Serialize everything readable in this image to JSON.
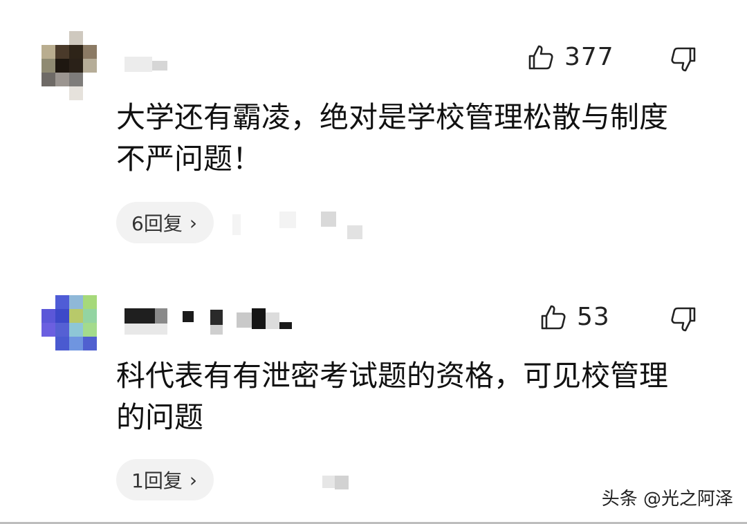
{
  "comments": [
    {
      "likes": "377",
      "text_line1": "大学还有霸凌，绝对是学校管理松散与制度",
      "text_line2": "不严问题！",
      "reply_label": "6回复"
    },
    {
      "likes": "53",
      "text_line1": "科代表有有泄密考试题的资格，可见校管理",
      "text_line2": "的问题",
      "reply_label": "1回复"
    }
  ],
  "watermark": "头条 @光之阿泽",
  "icons": {
    "like": "thumbs-up-icon",
    "dislike": "thumbs-down-icon",
    "reply_chevron": "chevron-right-icon"
  },
  "colors": {
    "pill_bg": "#f2f2f2",
    "text": "#111111",
    "background": "#ffffff"
  }
}
